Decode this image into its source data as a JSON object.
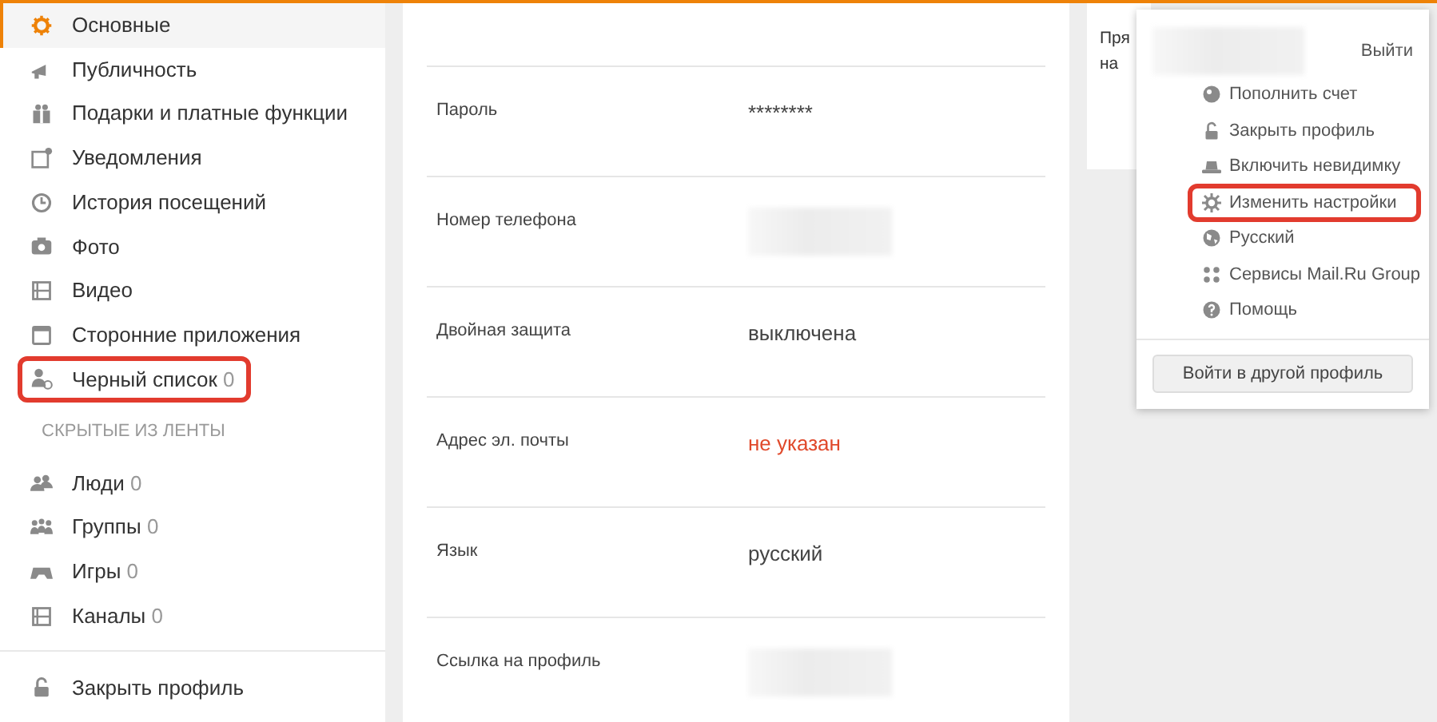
{
  "sidebar": {
    "items": [
      {
        "label": "Основные",
        "selected": true,
        "highlighted": false
      },
      {
        "label": "Публичность",
        "selected": false,
        "highlighted": false
      },
      {
        "label": "Подарки и платные функции",
        "selected": false,
        "highlighted": false
      },
      {
        "label": "Уведомления",
        "selected": false,
        "highlighted": false
      },
      {
        "label": "История посещений",
        "selected": false,
        "highlighted": false
      },
      {
        "label": "Фото",
        "selected": false,
        "highlighted": false
      },
      {
        "label": "Видео",
        "selected": false,
        "highlighted": false
      },
      {
        "label": "Сторонние приложения",
        "selected": false,
        "highlighted": false
      },
      {
        "label": "Черный список",
        "count": "0",
        "selected": false,
        "highlighted": true
      }
    ],
    "section_title": "СКРЫТЫЕ ИЗ ЛЕНТЫ",
    "hidden_items": [
      {
        "label": "Люди",
        "count": "0",
        "selected": false
      },
      {
        "label": "Группы",
        "count": "0",
        "selected": false
      },
      {
        "label": "Игры",
        "count": "0",
        "selected": false
      },
      {
        "label": "Каналы",
        "count": "0",
        "selected": false
      }
    ],
    "footer_item": "Закрыть профиль"
  },
  "settings_rows": [
    {
      "label": "Пароль",
      "value": "********",
      "kind": "text"
    },
    {
      "label": "Номер телефона",
      "kind": "redacted"
    },
    {
      "label": "Двойная защита",
      "value": "выключена",
      "kind": "text"
    },
    {
      "label": "Адрес эл. почты",
      "value": "не указан",
      "kind": "warning"
    },
    {
      "label": "Язык",
      "value": "русский",
      "kind": "text"
    },
    {
      "label": "Ссылка на профиль",
      "kind": "redacted"
    }
  ],
  "side_card": {
    "lines": [
      "Пря",
      "на"
    ]
  },
  "user_menu": {
    "logout": "Выйти",
    "items": [
      {
        "label": "Пополнить счет",
        "highlighted": false
      },
      {
        "label": "Закрыть профиль",
        "highlighted": false
      },
      {
        "label": "Включить невидимку",
        "highlighted": false
      },
      {
        "label": "Изменить настройки",
        "highlighted": true
      },
      {
        "label": "Русский",
        "highlighted": false
      },
      {
        "label": "Сервисы Mail.Ru Group",
        "highlighted": false
      },
      {
        "label": "Помощь",
        "highlighted": false
      }
    ],
    "switch_button": "Войти в другой профиль"
  }
}
